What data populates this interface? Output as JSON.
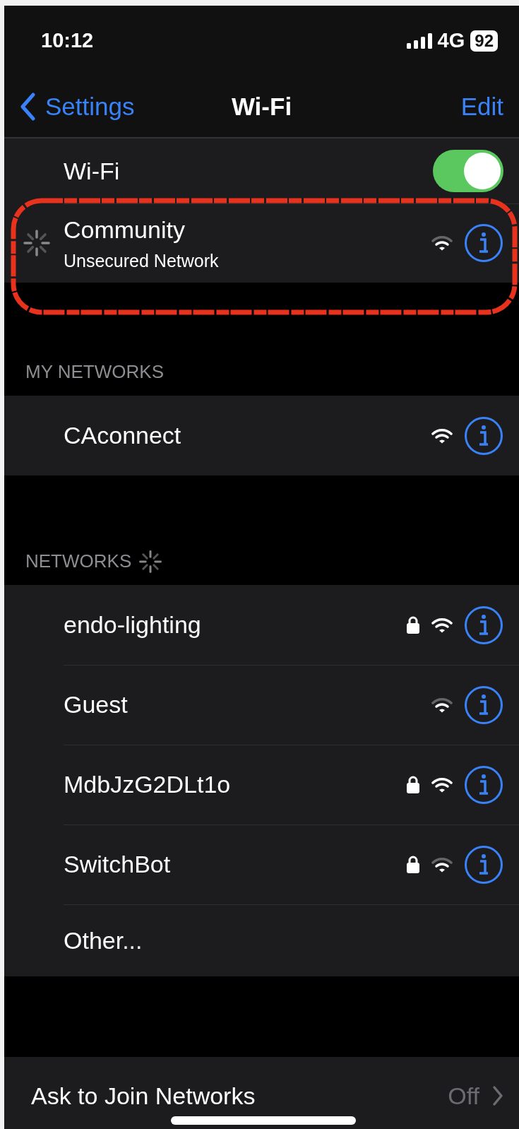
{
  "status_bar": {
    "time": "10:12",
    "network": "4G",
    "battery": "92"
  },
  "nav": {
    "back": "Settings",
    "title": "Wi-Fi",
    "action": "Edit"
  },
  "wifi_toggle": {
    "label": "Wi-Fi",
    "on": true
  },
  "current_network": {
    "name": "Community",
    "subtitle": "Unsecured Network",
    "connecting": true,
    "locked": false,
    "kind": "weak"
  },
  "my_networks": {
    "header": "MY NETWORKS",
    "items": [
      {
        "name": "CAconnect",
        "locked": false,
        "kind": "strong"
      }
    ]
  },
  "networks": {
    "header": "NETWORKS",
    "scanning": true,
    "items": [
      {
        "name": "endo-lighting",
        "locked": true,
        "kind": "strong"
      },
      {
        "name": "Guest",
        "locked": false,
        "kind": "weak"
      },
      {
        "name": "MdbJzG2DLt1o",
        "locked": true,
        "kind": "strong"
      },
      {
        "name": "SwitchBot",
        "locked": true,
        "kind": "weak"
      }
    ],
    "other": "Other..."
  },
  "ask_to_join": {
    "label": "Ask to Join Networks",
    "value": "Off"
  }
}
